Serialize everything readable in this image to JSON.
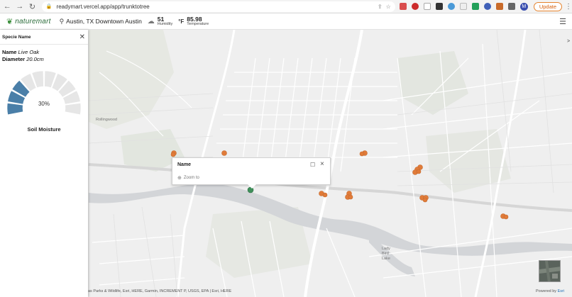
{
  "browser": {
    "url": "readymart.vercel.app/app/trunktotree",
    "update_label": "Update",
    "avatar_initial": "M"
  },
  "header": {
    "logo_text": "naturemart",
    "location": "Austin, TX Downtown Austin",
    "humidity_value": "51",
    "humidity_label": "Humidity",
    "temperature_unit": "°F",
    "temperature_value": "85.98",
    "temperature_label": "Temperature"
  },
  "panel": {
    "title": "Specie Name",
    "name_label": "Name",
    "name_value": "Live Oak",
    "diameter_label": "Diameter",
    "diameter_value": "20.0cm",
    "gauge_percent_text": "30%",
    "gauge_fraction": 0.3,
    "gauge_caption": "Soil Moisture"
  },
  "popup": {
    "title": "Name",
    "zoom_label": "Zoom to"
  },
  "map": {
    "place_labels": [
      "Rollingwood",
      "Lady Bird Lake"
    ],
    "attribution": "as Parks & Wildlife, Esri, HERE, Garmin, INCREMENT P, USGS, EPA | Esri, HERE",
    "powered_by": "Powered by",
    "powered_by_brand": "Esri"
  },
  "colors": {
    "marker": "#e07b39",
    "gauge_fill": "#4a7fa8",
    "gauge_empty": "#e6e6e6",
    "update_accent": "#e5842f"
  }
}
